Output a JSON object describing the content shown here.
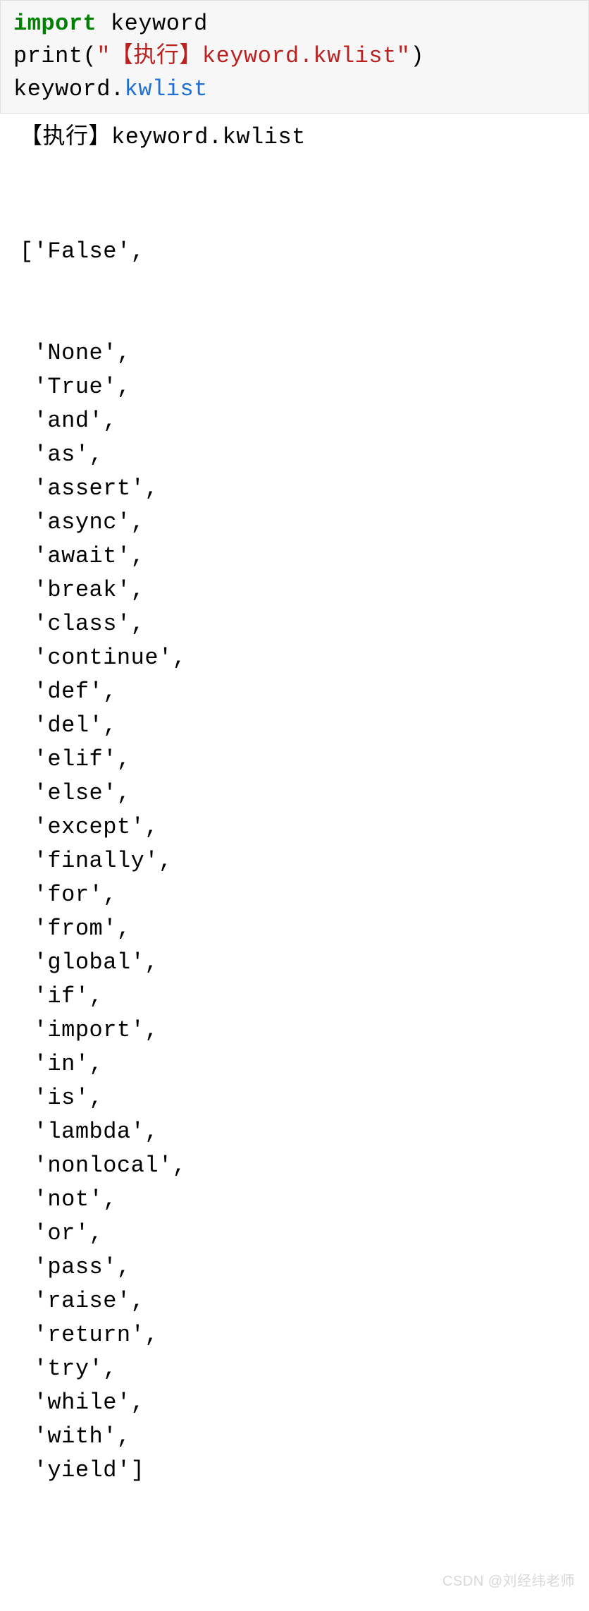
{
  "code": {
    "line1": {
      "import_kw": "import",
      "module": " keyword"
    },
    "line2": {
      "func": "print",
      "open": "(",
      "string": "\"【执行】keyword.kwlist\"",
      "close": ")"
    },
    "line3": {
      "obj": "keyword",
      "dot": ".",
      "attr": "kwlist"
    }
  },
  "output": {
    "header": "【执行】keyword.kwlist",
    "list_open": "['False',",
    "items": [
      " 'None',",
      " 'True',",
      " 'and',",
      " 'as',",
      " 'assert',",
      " 'async',",
      " 'await',",
      " 'break',",
      " 'class',",
      " 'continue',",
      " 'def',",
      " 'del',",
      " 'elif',",
      " 'else',",
      " 'except',",
      " 'finally',",
      " 'for',",
      " 'from',",
      " 'global',",
      " 'if',",
      " 'import',",
      " 'in',",
      " 'is',",
      " 'lambda',",
      " 'nonlocal',",
      " 'not',",
      " 'or',",
      " 'pass',",
      " 'raise',",
      " 'return',",
      " 'try',",
      " 'while',",
      " 'with',",
      " 'yield']"
    ]
  },
  "watermark": "CSDN @刘经纬老师"
}
